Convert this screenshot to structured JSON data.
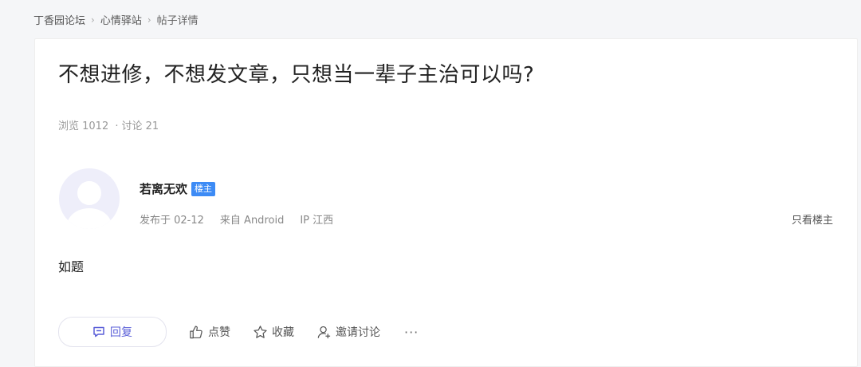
{
  "breadcrumb": [
    {
      "label": "丁香园论坛"
    },
    {
      "label": "心情驿站"
    },
    {
      "label": "帖子详情"
    }
  ],
  "post": {
    "title": "不想进修，不想发文章，只想当一辈子主治可以吗?",
    "views_label": "浏览 1012",
    "discussions_label": "讨论 21",
    "dot": "·",
    "content": "如题"
  },
  "author": {
    "name": "若离无欢",
    "badge": "楼主",
    "published": "发布于 02-12",
    "source": "来自 Android",
    "ip": "IP 江西",
    "only_op_label": "只看楼主"
  },
  "actions": {
    "reply": "回复",
    "like": "点赞",
    "favorite": "收藏",
    "invite": "邀请讨论",
    "more": "···"
  },
  "colors": {
    "accent": "#5a5fd8",
    "badge": "#3d8bf5"
  }
}
